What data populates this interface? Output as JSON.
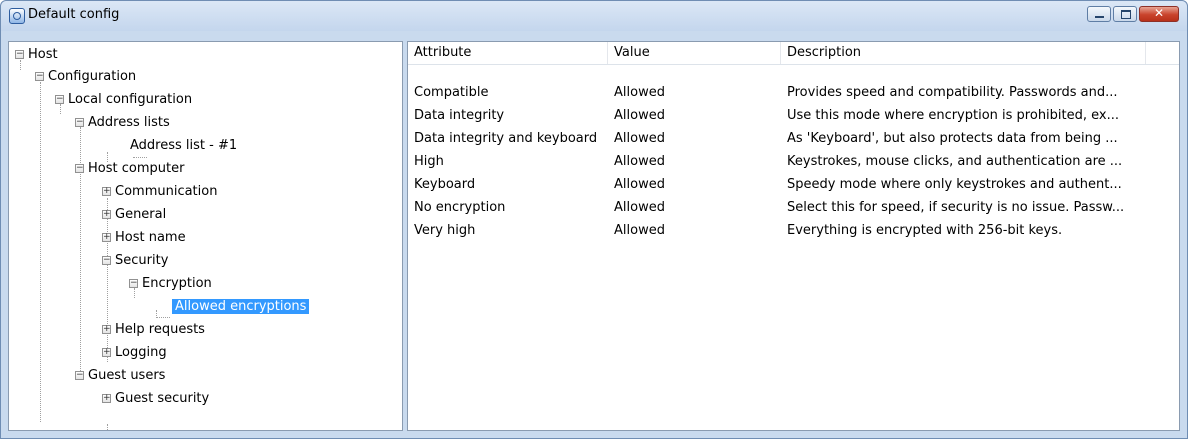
{
  "window": {
    "title": "Default config",
    "icon": "config-app-icon"
  },
  "tree": {
    "nodes": [
      {
        "label": "Host",
        "expanded": true
      },
      {
        "label": "Configuration",
        "expanded": true
      },
      {
        "label": "Local configuration",
        "expanded": true
      },
      {
        "label": "Address lists",
        "expanded": true
      },
      {
        "label": "Address list - #1"
      },
      {
        "label": "Host computer",
        "expanded": true
      },
      {
        "label": "Communication",
        "expanded": false
      },
      {
        "label": "General",
        "expanded": false
      },
      {
        "label": "Host name",
        "expanded": false
      },
      {
        "label": "Security",
        "expanded": true
      },
      {
        "label": "Encryption",
        "expanded": true
      },
      {
        "label": "Allowed encryptions",
        "selected": true
      },
      {
        "label": "Help requests",
        "expanded": false
      },
      {
        "label": "Logging",
        "expanded": false
      },
      {
        "label": "Guest users",
        "expanded": true
      },
      {
        "label": "Guest security",
        "expanded": false
      }
    ]
  },
  "list": {
    "columns": [
      "Attribute",
      "Value",
      "Description"
    ],
    "rows": [
      {
        "attribute": "Compatible",
        "value": "Allowed",
        "description": "Provides speed and compatibility. Passwords and..."
      },
      {
        "attribute": "Data integrity",
        "value": "Allowed",
        "description": "Use this mode where encryption is prohibited, ex..."
      },
      {
        "attribute": "Data integrity and keyboard",
        "value": "Allowed",
        "description": "As 'Keyboard', but also protects data from being ..."
      },
      {
        "attribute": "High",
        "value": "Allowed",
        "description": "Keystrokes, mouse clicks, and authentication are ..."
      },
      {
        "attribute": "Keyboard",
        "value": "Allowed",
        "description": "Speedy mode where only keystrokes and authent..."
      },
      {
        "attribute": "No encryption",
        "value": "Allowed",
        "description": "Select this for speed, if security is no issue. Passw..."
      },
      {
        "attribute": "Very high",
        "value": "Allowed",
        "description": "Everything is encrypted with 256-bit keys."
      }
    ]
  },
  "colors": {
    "selection": "#3399ff",
    "frame": "#c9daee",
    "close_button": "#c9432c"
  }
}
